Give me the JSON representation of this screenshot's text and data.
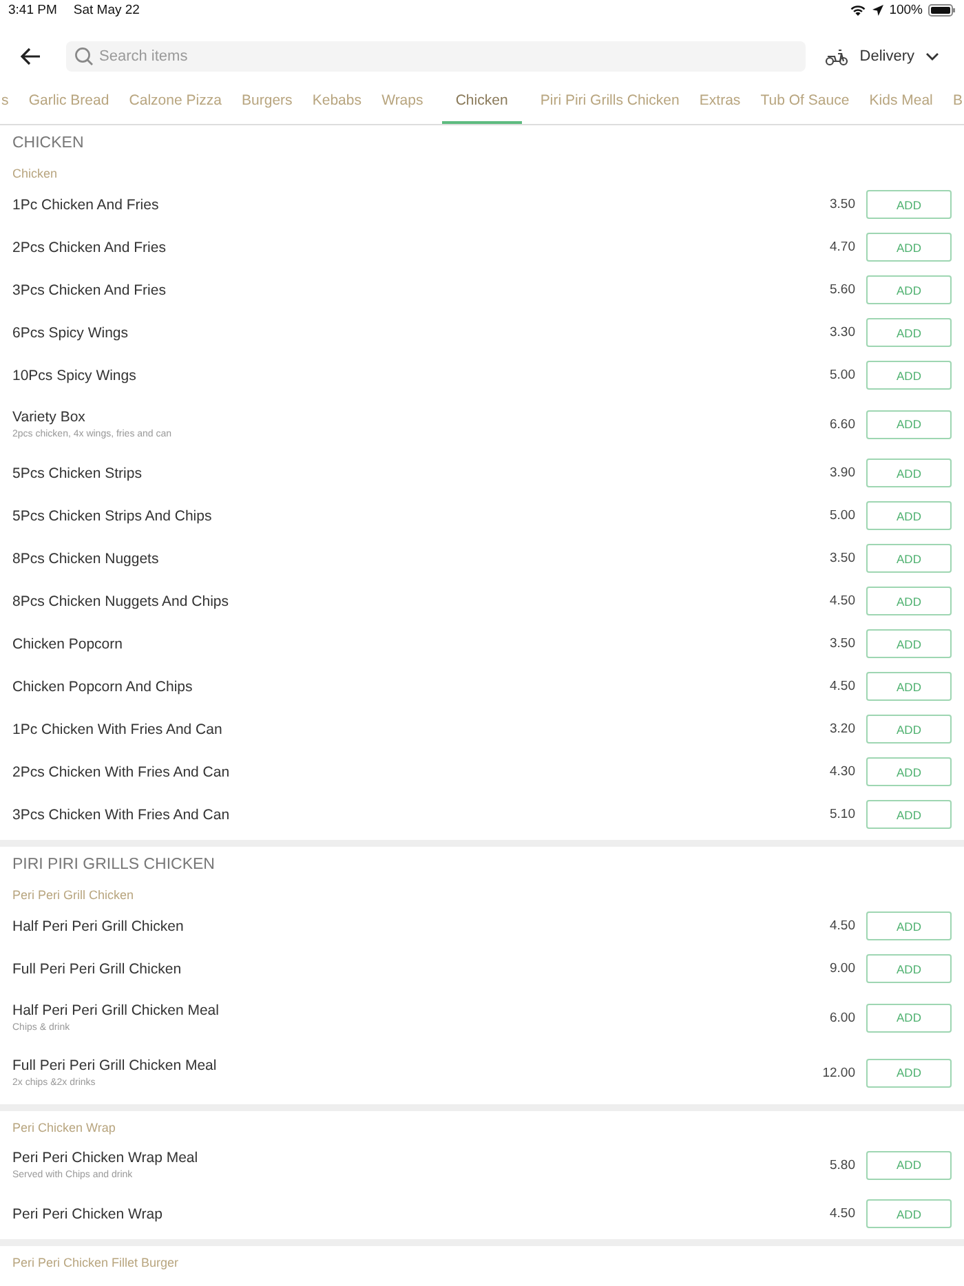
{
  "status_bar": {
    "time": "3:41 PM",
    "date": "Sat May 22",
    "battery": "100%"
  },
  "search": {
    "placeholder": "Search items"
  },
  "delivery": {
    "label": "Delivery"
  },
  "tabs": [
    {
      "label": "s",
      "selected": false
    },
    {
      "label": "Garlic Bread",
      "selected": false
    },
    {
      "label": "Calzone Pizza",
      "selected": false
    },
    {
      "label": "Burgers",
      "selected": false
    },
    {
      "label": "Kebabs",
      "selected": false
    },
    {
      "label": "Wraps",
      "selected": false
    },
    {
      "label": "Chicken",
      "selected": true
    },
    {
      "label": "Piri Piri Grills Chicken",
      "selected": false
    },
    {
      "label": "Extras",
      "selected": false
    },
    {
      "label": "Tub Of Sauce",
      "selected": false
    },
    {
      "label": "Kids Meal",
      "selected": false
    },
    {
      "label": "B",
      "selected": false
    }
  ],
  "sections": [
    {
      "title": "CHICKEN",
      "groups": [
        {
          "title": "Chicken",
          "items": [
            {
              "name": "1Pc Chicken And Fries",
              "price": "3.50",
              "button": "ADD"
            },
            {
              "name": "2Pcs Chicken And Fries",
              "price": "4.70",
              "button": "ADD"
            },
            {
              "name": "3Pcs Chicken And Fries",
              "price": "5.60",
              "button": "ADD"
            },
            {
              "name": "6Pcs Spicy Wings",
              "price": "3.30",
              "button": "ADD"
            },
            {
              "name": "10Pcs Spicy Wings",
              "price": "5.00",
              "button": "ADD"
            },
            {
              "name": "Variety Box",
              "description": "2pcs chicken, 4x wings, fries and can",
              "price": "6.60",
              "button": "ADD"
            },
            {
              "name": "5Pcs Chicken Strips",
              "price": "3.90",
              "button": "ADD"
            },
            {
              "name": "5Pcs Chicken Strips And Chips",
              "price": "5.00",
              "button": "ADD"
            },
            {
              "name": "8Pcs Chicken Nuggets",
              "price": "3.50",
              "button": "ADD"
            },
            {
              "name": "8Pcs Chicken Nuggets And Chips",
              "price": "4.50",
              "button": "ADD"
            },
            {
              "name": "Chicken Popcorn",
              "price": "3.50",
              "button": "ADD"
            },
            {
              "name": "Chicken Popcorn And Chips",
              "price": "4.50",
              "button": "ADD"
            },
            {
              "name": "1Pc Chicken With Fries And Can",
              "price": "3.20",
              "button": "ADD"
            },
            {
              "name": "2Pcs Chicken With Fries And Can",
              "price": "4.30",
              "button": "ADD"
            },
            {
              "name": "3Pcs Chicken With Fries And Can",
              "price": "5.10",
              "button": "ADD"
            }
          ]
        }
      ]
    },
    {
      "title": "PIRI PIRI GRILLS CHICKEN",
      "groups": [
        {
          "title": "Peri Peri Grill Chicken",
          "items": [
            {
              "name": "Half Peri Peri Grill Chicken",
              "price": "4.50",
              "button": "ADD"
            },
            {
              "name": "Full Peri Peri Grill Chicken",
              "price": "9.00",
              "button": "ADD"
            },
            {
              "name": "Half Peri Peri Grill Chicken Meal",
              "description": "Chips & drink",
              "price": "6.00",
              "button": "ADD"
            },
            {
              "name": "Full Peri Peri Grill Chicken Meal",
              "description": "2x chips &2x drinks",
              "price": "12.00",
              "button": "ADD"
            }
          ]
        },
        {
          "title": "Peri Chicken Wrap",
          "items": [
            {
              "name": "Peri Peri Chicken Wrap Meal",
              "description": "Served with Chips and drink",
              "price": "5.80",
              "button": "ADD"
            },
            {
              "name": "Peri Peri Chicken Wrap",
              "price": "4.50",
              "button": "ADD"
            }
          ]
        },
        {
          "title": "Peri Peri Chicken Fillet Burger"
        }
      ]
    }
  ]
}
